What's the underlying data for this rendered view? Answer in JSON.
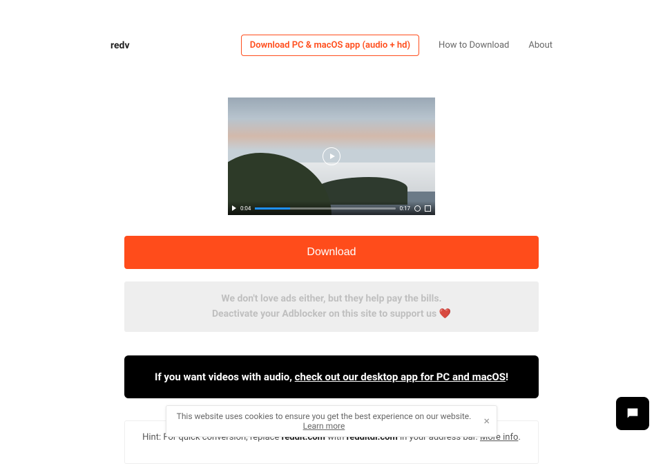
{
  "header": {
    "brand": "redv",
    "app_link": "Download PC & macOS app (audio + hd)",
    "howto": "How to Download",
    "about": "About"
  },
  "video": {
    "current_time": "0:04",
    "duration": "0:17"
  },
  "download_label": "Download",
  "ad_notice": {
    "line1": "We don't love ads either, but they help pay the bills.",
    "line2_prefix": "Deactivate your Adblocker on this site to support us ",
    "heart": "❤️"
  },
  "desktop_banner": {
    "prefix": "If you want videos with audio, ",
    "link": "check out our desktop app for PC and macOS",
    "suffix": "!"
  },
  "hint": {
    "prefix": "Hint: For quick conversion, replace ",
    "from": "reddit.com",
    "mid": " with ",
    "to": "redditdl.com",
    "suffix": " in your address bar. ",
    "more": "More info"
  },
  "cookie": {
    "text": "This website uses cookies to ensure you get the best experience on our website. ",
    "learn": "Learn more"
  }
}
